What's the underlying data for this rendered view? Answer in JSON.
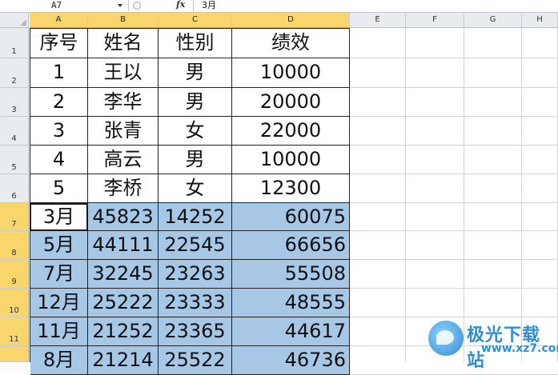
{
  "formula_bar": {
    "name_box": "A7",
    "fx_label": "fx",
    "content": "3月"
  },
  "columns": [
    "A",
    "B",
    "C",
    "D",
    "E",
    "F",
    "G",
    "H"
  ],
  "rows": [
    "1",
    "2",
    "3",
    "4",
    "5",
    "6",
    "7",
    "8",
    "9",
    "10",
    "11"
  ],
  "selection": {
    "active_cell": "A7",
    "range": "A7:D12",
    "highlight_color": "#a7c7e7",
    "header_highlight_color": "#f8d66b"
  },
  "cells": [
    [
      "序号",
      "姓名",
      "性别",
      "绩效"
    ],
    [
      "1",
      "王以",
      "男",
      "10000"
    ],
    [
      "2",
      "李华",
      "男",
      "20000"
    ],
    [
      "3",
      "张青",
      "女",
      "22000"
    ],
    [
      "4",
      "高云",
      "男",
      "10000"
    ],
    [
      "5",
      "李桥",
      "女",
      "12300"
    ],
    [
      "3月",
      "45823",
      "14252",
      "60075"
    ],
    [
      "5月",
      "44111",
      "22545",
      "66656"
    ],
    [
      "7月",
      "32245",
      "23263",
      "55508"
    ],
    [
      "12月",
      "25222",
      "23333",
      "48555"
    ],
    [
      "11月",
      "21252",
      "23365",
      "44617"
    ],
    [
      "8月",
      "21214",
      "25522",
      "46736"
    ]
  ],
  "watermark": {
    "name": "极光下载站",
    "url": "www.xz7.com"
  }
}
